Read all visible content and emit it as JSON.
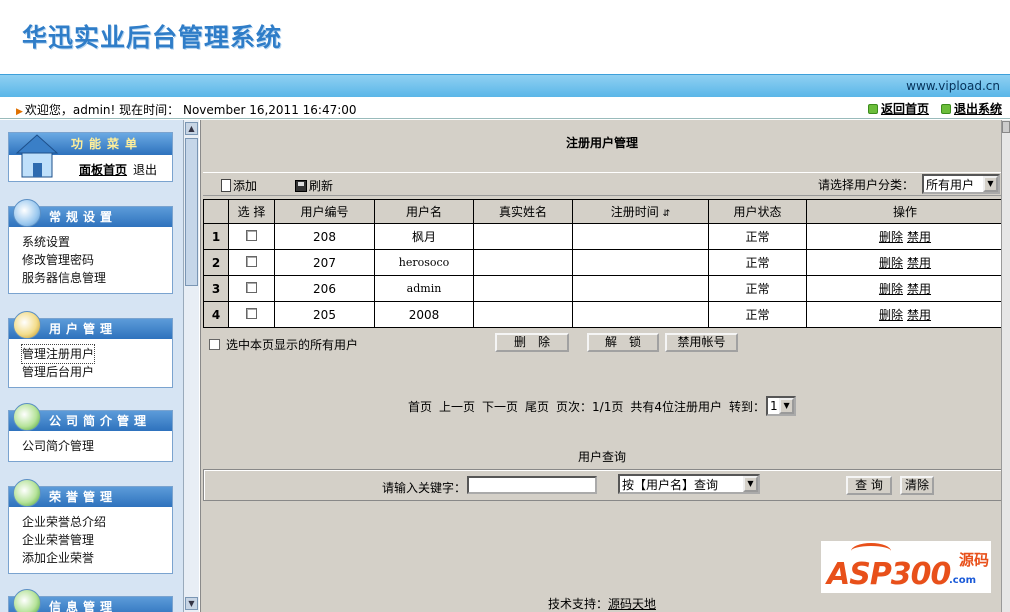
{
  "header": {
    "title": "华迅实业后台管理系统",
    "site": "www.vipload.cn"
  },
  "welcome": {
    "text": "欢迎您，admin! 现在时间： November 16,2011 16:47:00",
    "back_home": "返回首页",
    "logout": "退出系统"
  },
  "sidebar": {
    "top": {
      "title": "功能菜单",
      "panel_home": "面板首页",
      "exit": "退出"
    },
    "groups": [
      {
        "title": "常规设置",
        "items": [
          "系统设置",
          "修改管理密码",
          "服务器信息管理"
        ]
      },
      {
        "title": "用户管理",
        "items": [
          "管理注册用户",
          "管理后台用户"
        ]
      },
      {
        "title": "公司简介管理",
        "items": [
          "公司简介管理"
        ]
      },
      {
        "title": "荣誉管理",
        "items": [
          "企业荣誉总介绍",
          "企业荣誉管理",
          "添加企业荣誉"
        ]
      },
      {
        "title": "信息管理",
        "items": []
      }
    ]
  },
  "main": {
    "title": "注册用户管理",
    "toolbar": {
      "add": "添加",
      "refresh": "刷新",
      "category_label": "请选择用户分类：",
      "category_value": "所有用户"
    },
    "table": {
      "headers": [
        "选 择",
        "用户编号",
        "用户名",
        "真实姓名",
        "注册时间",
        "用户状态",
        "操作"
      ],
      "rows": [
        {
          "idx": "1",
          "id": "208",
          "username": "枫月",
          "realname": "",
          "regtime": "",
          "status": "正常"
        },
        {
          "idx": "2",
          "id": "207",
          "username": "herosoco",
          "realname": "",
          "regtime": "",
          "status": "正常"
        },
        {
          "idx": "3",
          "id": "206",
          "username": "admin",
          "realname": "",
          "regtime": "",
          "status": "正常"
        },
        {
          "idx": "4",
          "id": "205",
          "username": "2008",
          "realname": "",
          "regtime": "",
          "status": "正常"
        }
      ],
      "action_delete": "删除",
      "action_disable": "禁用"
    },
    "bulk": {
      "select_all": "选中本页显示的所有用户",
      "delete": "删　除",
      "unlock": "解　锁",
      "disable": "禁用帐号"
    },
    "pager": {
      "first": "首页",
      "prev": "上一页",
      "next": "下一页",
      "last": "尾页",
      "pages": "页次：1/1页",
      "total": "共有4位注册用户",
      "goto": "转到：",
      "page": "1"
    },
    "query": {
      "title": "用户查询",
      "label": "请输入关键字：",
      "input_value": "",
      "mode": "按【用户名】查询",
      "search": "查 询",
      "clear": "清除"
    },
    "logo": {
      "main": "ASP300",
      "yuan": "源码",
      "com": ".com"
    },
    "support_label": "技术支持：",
    "support_link": "源码天地"
  },
  "colors": {
    "header_blue": "#2f7dc8",
    "bar_blue": "#5ab6e8",
    "panel_gray": "#d4d0c8",
    "sidebar_bg": "#d6e4f3"
  }
}
